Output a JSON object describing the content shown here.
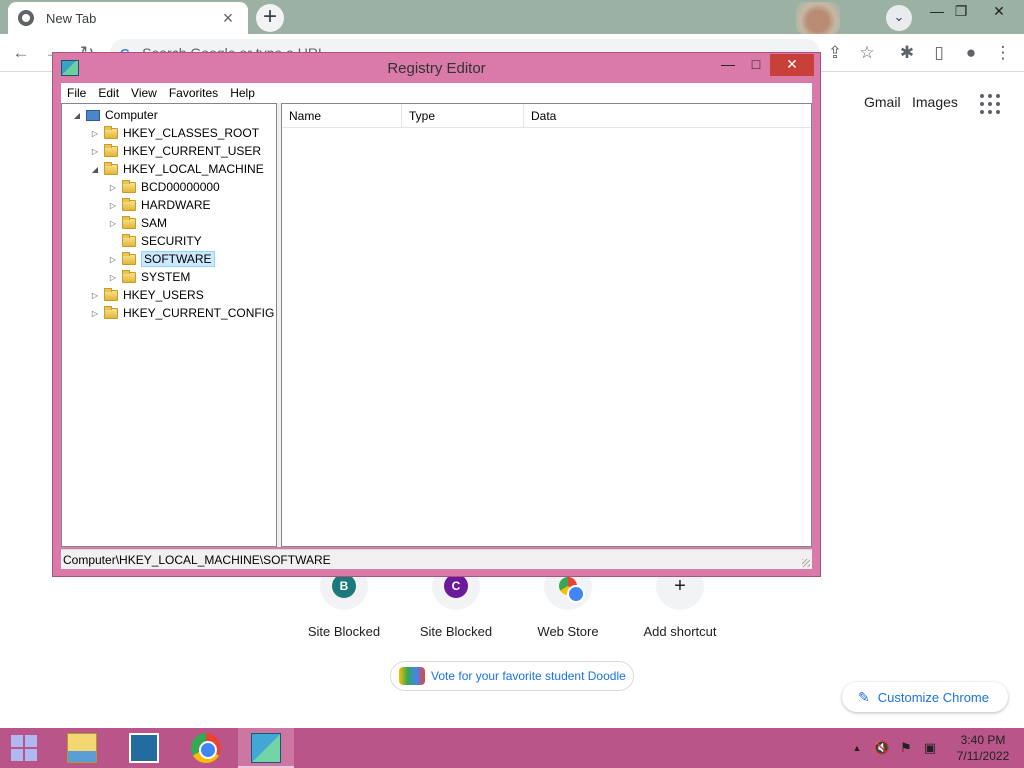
{
  "browser": {
    "tab_title": "New Tab",
    "tab_close": "×",
    "new_tab": "+",
    "omnibox_placeholder": "Search Google or type a URL",
    "omnibox_g": "G",
    "window_controls": {
      "minimize": "—",
      "restore": "❐",
      "close": "✕"
    },
    "toolbar_icons": {
      "back": "←",
      "forward": "→",
      "reload": "↻",
      "share": "⇪",
      "bookmark": "☆",
      "extensions": "✱",
      "sidepanel": "▯",
      "profile": "●",
      "menu": "⋮",
      "tab_search": "⌄"
    }
  },
  "google": {
    "gmail": "Gmail",
    "images": "Images",
    "shortcuts": [
      {
        "label": "Site Blocked",
        "letter": "B",
        "color": "#1a7a7a"
      },
      {
        "label": "Site Blocked",
        "letter": "C",
        "color": "#6a1b9a"
      },
      {
        "label": "Web Store",
        "letter": "",
        "color": "#ea4335"
      },
      {
        "label": "Add shortcut",
        "letter": "+",
        "color": "#f1f3f4"
      }
    ],
    "doodle_vote": "Vote for your favorite student Doodle",
    "customize": "Customize Chrome",
    "customize_icon": "✎"
  },
  "regedit": {
    "title": "Registry Editor",
    "buttons": {
      "minimize": "—",
      "maximize": "□",
      "close": "✕"
    },
    "menu": [
      "File",
      "Edit",
      "View",
      "Favorites",
      "Help"
    ],
    "tree": {
      "root": "Computer",
      "hives": [
        "HKEY_CLASSES_ROOT",
        "HKEY_CURRENT_USER",
        "HKEY_LOCAL_MACHINE"
      ],
      "hklm_children": [
        "BCD00000000",
        "HARDWARE",
        "SAM",
        "SECURITY",
        "SOFTWARE",
        "SYSTEM"
      ],
      "hives_after": [
        "HKEY_USERS",
        "HKEY_CURRENT_CONFIG"
      ],
      "selected": "SOFTWARE"
    },
    "columns": [
      "Name",
      "Type",
      "Data"
    ],
    "status_path": "Computer\\HKEY_LOCAL_MACHINE\\SOFTWARE"
  },
  "taskbar": {
    "clock_time": "3:40 PM",
    "clock_date": "7/11/2022",
    "tray_icons": {
      "chevron": "▲",
      "volume": "🔇",
      "flag": "⚑",
      "network": "▣"
    }
  }
}
